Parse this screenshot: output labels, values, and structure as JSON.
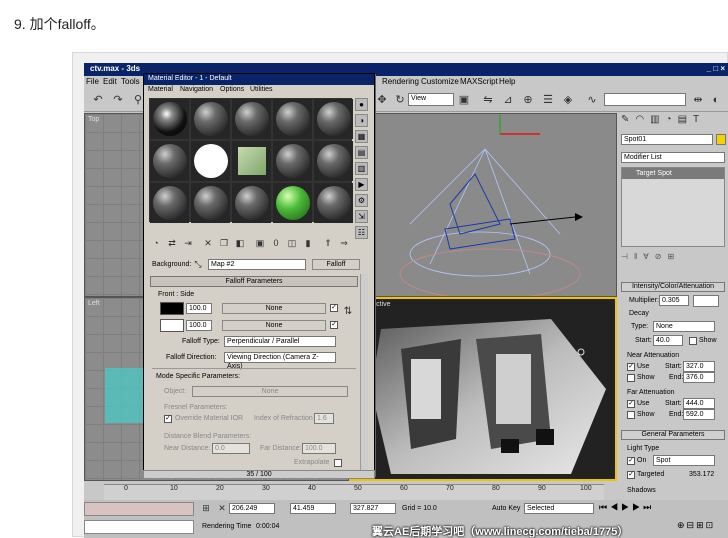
{
  "caption": "9. 加个falloff。",
  "app": {
    "title": "ctv.max - 3ds",
    "title_ctrl": "_ □ ×",
    "menus": [
      "File",
      "Edit",
      "Tools",
      "Rendering",
      "Customize",
      "MAXScript",
      "Help"
    ],
    "view_select": "View"
  },
  "viewports": {
    "top": "Top",
    "left": "Left",
    "perspective": "Perspective"
  },
  "material_editor": {
    "title": "Material Editor - 1 - Default",
    "menus": [
      "Material",
      "Navigation",
      "Options",
      "Utilities"
    ],
    "background_label": "Background:",
    "map_name": "Map #2",
    "map_type": "Falloff",
    "rollout_title": "Falloff Parameters",
    "front_side_label": "Front : Side",
    "front_value": "100.0",
    "side_value": "100.0",
    "map_none_1": "None",
    "map_none_2": "None",
    "falloff_type_label": "Falloff Type:",
    "falloff_type": "Perpendicular / Parallel",
    "falloff_dir_label": "Falloff Direction:",
    "falloff_dir": "Viewing Direction (Camera Z-Axis)",
    "mode_label": "Mode Specific Parameters:",
    "object_label": "Object:",
    "object_value": "None",
    "fresnel_label": "Fresnel Parameters:",
    "override_label": "Override Material IOR",
    "ior_label": "Index of Refraction",
    "ior_value": "1.6",
    "distance_label": "Distance Blend Parameters:",
    "near_label": "Near Distance:",
    "near_value": "0.0",
    "far_label": "Far Distance:",
    "far_value": "100.0",
    "extrapolate_label": "Extrapolate"
  },
  "command_panel": {
    "object_name": "Spot01",
    "modifier_list": "Modifier List",
    "stack_item": "Target Spot",
    "intensity_header": "Intensity/Color/Attenuation",
    "multiplier_label": "Multiplier:",
    "multiplier_value": "0.305",
    "decay_label": "Decay",
    "decay_type_label": "Type:",
    "decay_type": "None",
    "decay_start_label": "Start:",
    "decay_start": "40.0",
    "decay_show": "Show",
    "near_atten_label": "Near Attenuation",
    "near_use": "Use",
    "near_show": "Show",
    "near_start_label": "Start:",
    "near_start": "327.0",
    "near_end_label": "End:",
    "near_end": "376.0",
    "far_atten_label": "Far Attenuation",
    "far_use": "Use",
    "far_show": "Show",
    "far_start_label": "Start:",
    "far_start": "444.0",
    "far_end_label": "End:",
    "far_end": "592.0",
    "general_header": "General Parameters",
    "light_type_label": "Light Type",
    "light_on": "On",
    "light_type": "Spot",
    "targeted_label": "Targeted",
    "targeted_value": "353.172",
    "shadows_label": "Shadows"
  },
  "timeline": {
    "frame": "35 / 100",
    "ticks": [
      "0",
      "10",
      "20",
      "30",
      "40",
      "50",
      "60",
      "70",
      "80",
      "90",
      "100"
    ]
  },
  "status": {
    "x": "206.249",
    "y": "41.459",
    "z": "327.827",
    "grid": "Grid = 10.0",
    "autokey": "Auto Key",
    "selected": "Selected",
    "render_time_label": "Rendering Time",
    "render_time": "0:00:04"
  },
  "watermark": "翼云AE后期学习吧（www.linecg.com/tieba/1775）",
  "colors": {
    "title_bar": "#0a246a",
    "viewport_grey": "#8c8c8c",
    "active_border": "#f2c200"
  }
}
